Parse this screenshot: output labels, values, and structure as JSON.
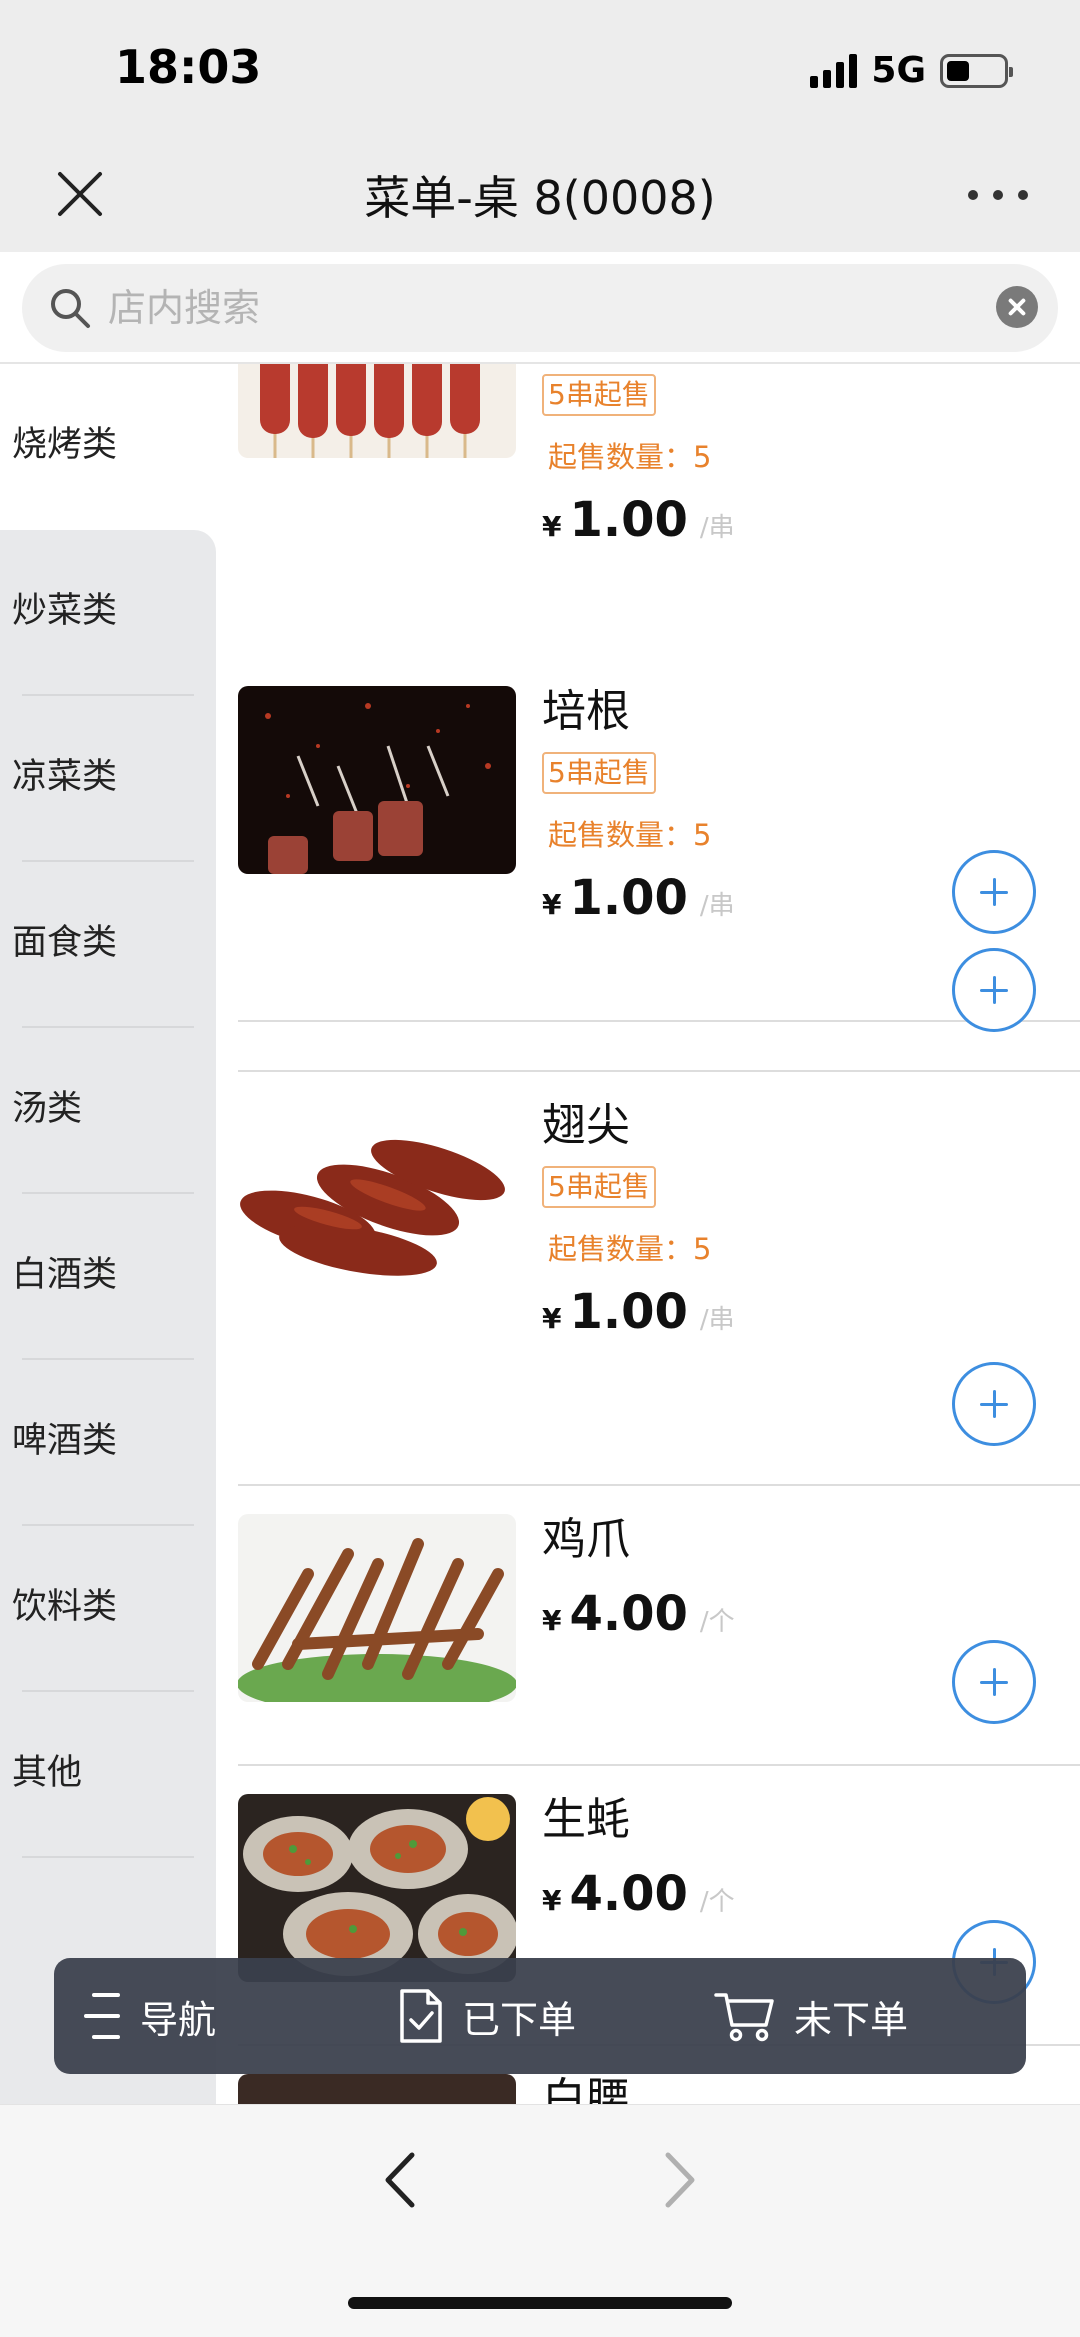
{
  "status_bar": {
    "time": "18:03",
    "network": "5G",
    "battery_level": 0.3
  },
  "nav": {
    "title": "菜单-桌 8(0008)",
    "close_icon": "close-icon",
    "more_icon": "more-icon"
  },
  "search": {
    "placeholder": "店内搜索",
    "value": ""
  },
  "sidebar": {
    "items": [
      {
        "label": "烧烤类",
        "active": true
      },
      {
        "label": "炒菜类"
      },
      {
        "label": "凉菜类"
      },
      {
        "label": "面食类"
      },
      {
        "label": "汤类"
      },
      {
        "label": "白酒类"
      },
      {
        "label": "啤酒类"
      },
      {
        "label": "饮料类"
      },
      {
        "label": "其他"
      }
    ]
  },
  "products": [
    {
      "name": "",
      "tag": "5串起售",
      "min_qty": "起售数量：5",
      "currency": "¥",
      "price": "1.00",
      "unit": "/串"
    },
    {
      "name": "培根",
      "tag": "5串起售",
      "min_qty": "起售数量：5",
      "currency": "¥",
      "price": "1.00",
      "unit": "/串"
    },
    {
      "name": "翅尖",
      "tag": "5串起售",
      "min_qty": "起售数量：5",
      "currency": "¥",
      "price": "1.00",
      "unit": "/串"
    },
    {
      "name": "鸡爪",
      "currency": "¥",
      "price": "4.00",
      "unit": "/个"
    },
    {
      "name": "生蚝",
      "currency": "¥",
      "price": "4.00",
      "unit": "/个"
    },
    {
      "name": "白腰"
    }
  ],
  "action_bar": {
    "nav_label": "导航",
    "ordered_label": "已下单",
    "unordered_label": "未下单"
  },
  "colors": {
    "accent": "#3d8ee0",
    "tag_orange": "#e8822c",
    "bar": "#3a404d"
  }
}
